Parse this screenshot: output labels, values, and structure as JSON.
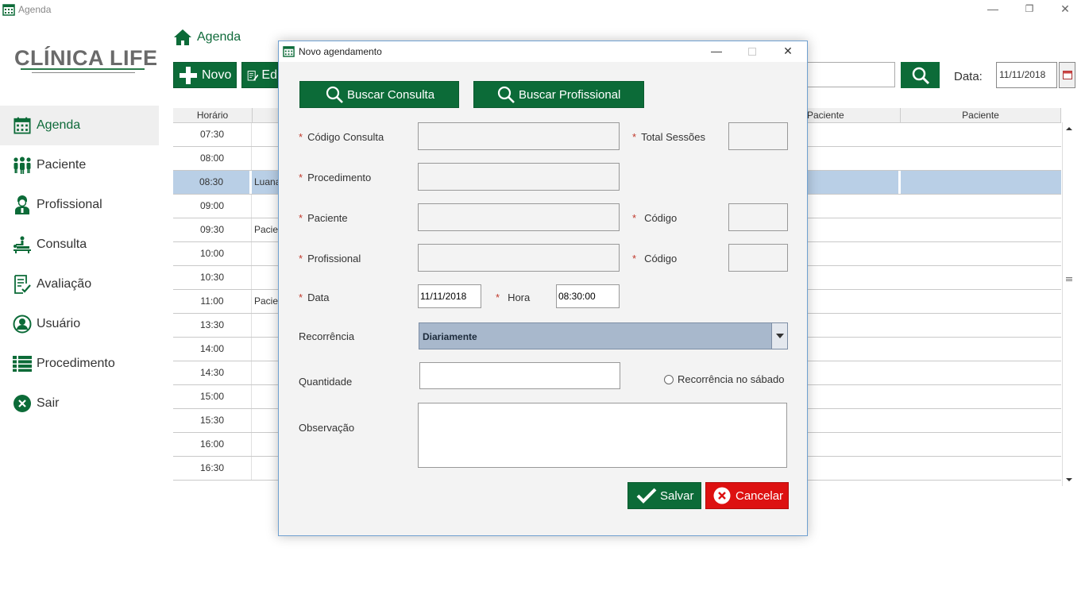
{
  "window": {
    "title": "Agenda",
    "minimize": "—",
    "restore": "❐",
    "close": "✕"
  },
  "logo": {
    "text": "CLÍNICA LIFE"
  },
  "sidebar": {
    "items": [
      {
        "label": "Agenda",
        "icon": "calendar-icon"
      },
      {
        "label": "Paciente",
        "icon": "people-icon"
      },
      {
        "label": "Profissional",
        "icon": "doctor-icon"
      },
      {
        "label": "Consulta",
        "icon": "therapy-icon"
      },
      {
        "label": "Avaliação",
        "icon": "checklist-icon"
      },
      {
        "label": "Usuário",
        "icon": "user-icon"
      },
      {
        "label": "Procedimento",
        "icon": "list-icon"
      },
      {
        "label": "Sair",
        "icon": "exit-icon"
      }
    ]
  },
  "breadcrumb": {
    "label": "Agenda"
  },
  "toolbar": {
    "new_label": "Novo",
    "edit_label": "Ed",
    "date_label": "Data:",
    "date_value": "11/11/2018"
  },
  "grid": {
    "headers": [
      "Horário",
      "Paciente",
      "Paciente"
    ],
    "rows": [
      {
        "time": "07:30",
        "patient": ""
      },
      {
        "time": "08:00",
        "patient": ""
      },
      {
        "time": "08:30",
        "patient": "Luana"
      },
      {
        "time": "09:00",
        "patient": ""
      },
      {
        "time": "09:30",
        "patient": "Pacie"
      },
      {
        "time": "10:00",
        "patient": ""
      },
      {
        "time": "10:30",
        "patient": ""
      },
      {
        "time": "11:00",
        "patient": "Pacie"
      },
      {
        "time": "13:30",
        "patient": ""
      },
      {
        "time": "14:00",
        "patient": ""
      },
      {
        "time": "14:30",
        "patient": ""
      },
      {
        "time": "15:00",
        "patient": ""
      },
      {
        "time": "15:30",
        "patient": ""
      },
      {
        "time": "16:00",
        "patient": ""
      },
      {
        "time": "16:30",
        "patient": ""
      }
    ],
    "selected_time": "08:30"
  },
  "modal": {
    "title": "Novo agendamento",
    "buscar_consulta": "Buscar Consulta",
    "buscar_profissional": "Buscar Profissional",
    "required_mark": "*",
    "fields": {
      "codigo_consulta": "Código Consulta",
      "total_sessoes": "Total Sessões",
      "procedimento": "Procedimento",
      "paciente": "Paciente",
      "codigo_paciente": "Código",
      "profissional": "Profissional",
      "codigo_profissional": "Código",
      "data": "Data",
      "data_value": "11/11/2018",
      "hora": "Hora",
      "hora_value": "08:30:00",
      "recorrencia": "Recorrência",
      "recorrencia_value": "Diariamente",
      "quantidade": "Quantidade",
      "recorrencia_sabado": "Recorrência no sábado",
      "observacao": "Observação"
    },
    "save_label": "Salvar",
    "cancel_label": "Cancelar"
  },
  "colors": {
    "brand_green": "#0c6b38",
    "cancel_red": "#dd1111",
    "selection_blue": "#b9cfe6"
  }
}
